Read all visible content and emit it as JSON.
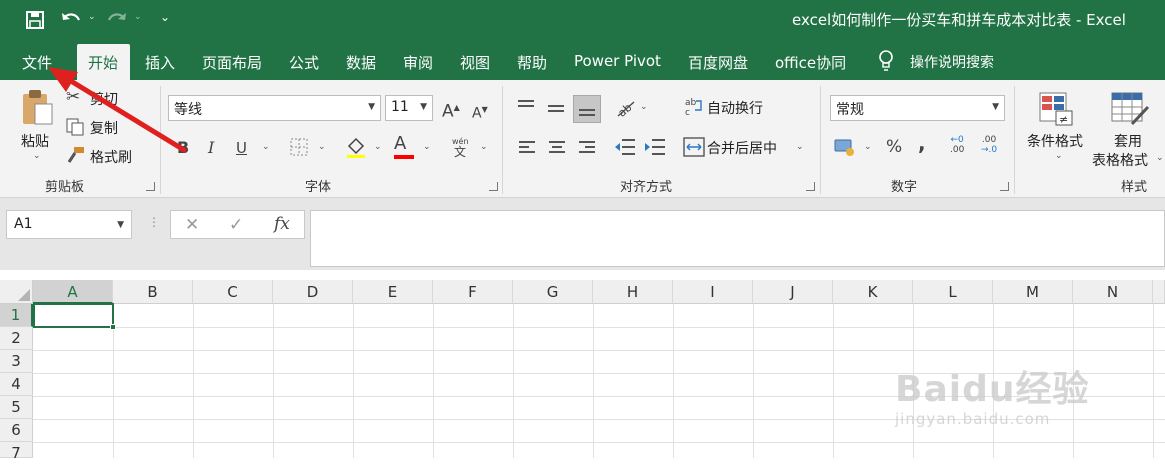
{
  "window": {
    "title": "excel如何制作一份买车和拼车成本对比表  -  Excel"
  },
  "quick_access": {
    "save_icon": "save-icon",
    "undo_icon": "undo-icon",
    "redo_icon": "redo-icon"
  },
  "tabs": [
    "文件",
    "开始",
    "插入",
    "页面布局",
    "公式",
    "数据",
    "审阅",
    "视图",
    "帮助",
    "Power Pivot",
    "百度网盘",
    "office协同"
  ],
  "tell_me": "操作说明搜索",
  "clipboard": {
    "paste": "粘贴",
    "cut": "剪切",
    "copy": "复制",
    "format_painter": "格式刷",
    "label": "剪贴板"
  },
  "font": {
    "name": "等线",
    "size": "11",
    "label": "字体",
    "bold": "B",
    "italic": "I",
    "underline": "U",
    "font_color_letter": "A",
    "phonetic_top": "wén",
    "phonetic_bottom": "文",
    "grow": "A",
    "shrink": "A",
    "font_color": "#ff0000"
  },
  "alignment": {
    "wrap": "自动换行",
    "merge": "合并后居中",
    "label": "对齐方式"
  },
  "number": {
    "format": "常规",
    "label": "数字",
    "percent": "%",
    "comma": ",",
    "inc_decimal_top": "←0",
    "inc_decimal_bottom": ".00",
    "dec_decimal_top": ".00",
    "dec_decimal_bottom": "→.0"
  },
  "styles": {
    "conditional": "条件格式",
    "table_format_1": "套用",
    "table_format_2": "表格格式",
    "label": "样式"
  },
  "formula_bar": {
    "name_box": "A1",
    "cancel": "✕",
    "enter": "✓",
    "fx": "fx",
    "value": ""
  },
  "sheet": {
    "columns": [
      "A",
      "B",
      "C",
      "D",
      "E",
      "F",
      "G",
      "H",
      "I",
      "J",
      "K",
      "L",
      "M",
      "N"
    ],
    "rows": [
      "1",
      "2",
      "3",
      "4",
      "5",
      "6",
      "7"
    ],
    "active_cell": "A1"
  },
  "watermark": {
    "brand": "Baidu经验",
    "url": "jingyan.baidu.com"
  },
  "colors": {
    "accent": "#217346",
    "arrow": "#e0201f"
  }
}
